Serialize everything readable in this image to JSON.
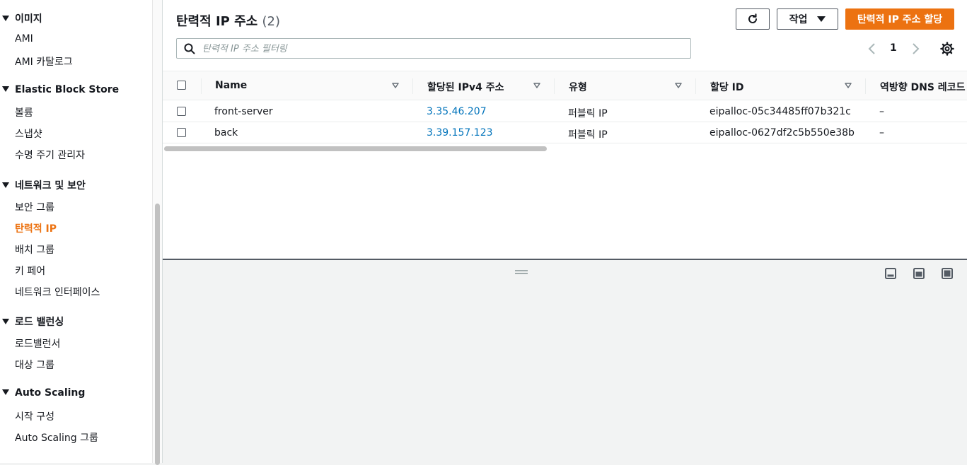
{
  "sidebar": {
    "groups": [
      {
        "label": "이미지",
        "items": [
          "AMI",
          "AMI 카탈로그"
        ]
      },
      {
        "label": "Elastic Block Store",
        "items": [
          "볼륨",
          "스냅샷",
          "수명 주기 관리자"
        ]
      },
      {
        "label": "네트워크 및 보안",
        "items": [
          "보안 그룹",
          "탄력적 IP",
          "배치 그룹",
          "키 페어",
          "네트워크 인터페이스"
        ]
      },
      {
        "label": "로드 밸런싱",
        "items": [
          "로드밸런서",
          "대상 그룹"
        ]
      },
      {
        "label": "Auto Scaling",
        "items": [
          "시작 구성",
          "Auto Scaling 그룹"
        ]
      }
    ],
    "active_item": "탄력적 IP"
  },
  "header": {
    "title": "탄력적 IP 주소",
    "count": "(2)",
    "actions_label": "작업",
    "primary_label": "탄력적 IP 주소 할당"
  },
  "search": {
    "placeholder": "탄력적 IP 주소 필터링",
    "value": ""
  },
  "pagination": {
    "current_page": "1"
  },
  "table": {
    "columns": [
      "Name",
      "할당된 IPv4 주소",
      "유형",
      "할당 ID",
      "역방향 DNS 레코드"
    ],
    "rows": [
      {
        "name": "front-server",
        "ipv4": "3.35.46.207",
        "type": "퍼블릭 IP",
        "allocation_id": "eipalloc-05c34485ff07b321c",
        "reverse_dns": "–"
      },
      {
        "name": "back",
        "ipv4": "3.39.157.123",
        "type": "퍼블릭 IP",
        "allocation_id": "eipalloc-0627df2c5b550e38b",
        "reverse_dns": "–"
      }
    ]
  },
  "colors": {
    "accent": "#ec7211",
    "link": "#0073bb",
    "text": "#16191f"
  }
}
